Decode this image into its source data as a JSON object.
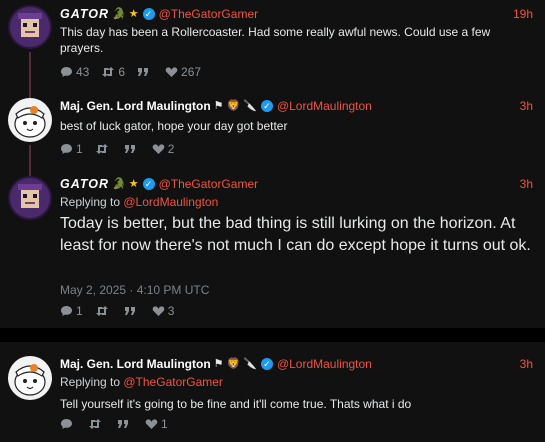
{
  "posts": [
    {
      "name": "GATOR",
      "handle": "@TheGatorGamer",
      "time": "19h",
      "text": "This day has been a Rollercoaster. Had some really awful news. Could use a few prayers.",
      "replies": "43",
      "reposts": "6",
      "quotes": "",
      "likes": "267"
    },
    {
      "name": "Maj. Gen. Lord Maulington",
      "handle": "@LordMaulington",
      "time": "3h",
      "text": "best of luck gator, hope your day got better",
      "replies": "1",
      "reposts": "",
      "quotes": "",
      "likes": "2"
    },
    {
      "name": "GATOR",
      "handle": "@TheGatorGamer",
      "time": "3h",
      "replying_prefix": "Replying to ",
      "replying_to": "@LordMaulington",
      "text": "Today is better, but the bad thing is still lurking on the horizon. At least for now there's not much I can do except hope it turns out ok.",
      "timestamp": "May 2, 2025 · 4:10 PM UTC",
      "replies": "1",
      "reposts": "",
      "quotes": "",
      "likes": "3"
    },
    {
      "name": "Maj. Gen. Lord Maulington",
      "handle": "@LordMaulington",
      "time": "3h",
      "replying_prefix": "Replying to ",
      "replying_to": "@TheGatorGamer",
      "text": "Tell yourself it's going to be fine and it'll come true. Thats what i do",
      "replies": "",
      "reposts": "",
      "quotes": "",
      "likes": "1"
    }
  ],
  "colors": {
    "accent": "#f0533e",
    "verified": "#1d9bf0",
    "card": "#111111",
    "thread": "#5b2a3a"
  },
  "icons": [
    "reply-icon",
    "repost-icon",
    "quote-icon",
    "heart-icon",
    "verified-icon",
    "star-icon",
    "alligator-icon",
    "flag-icon",
    "lion-icon",
    "knife-icon"
  ]
}
